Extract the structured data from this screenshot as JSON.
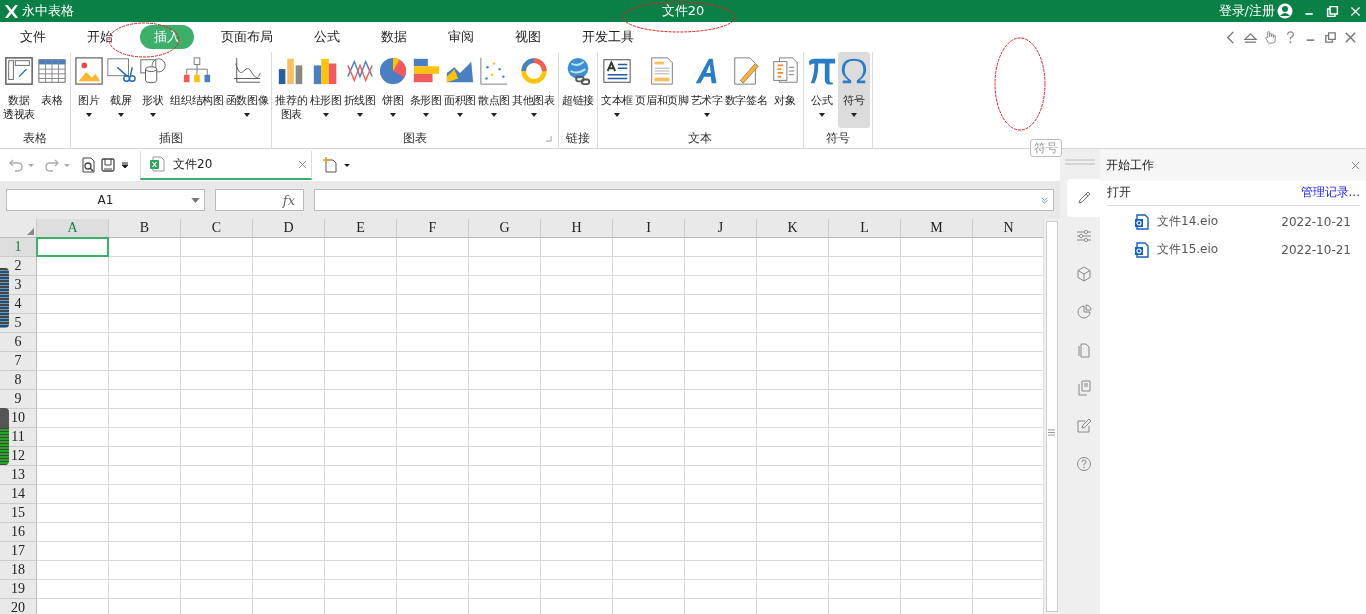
{
  "app": {
    "name": "永中表格"
  },
  "window": {
    "title": "文件20",
    "account_link": "登录/注册"
  },
  "menu_tabs": [
    {
      "label": "文件",
      "selected": false
    },
    {
      "label": "开始",
      "selected": false
    },
    {
      "label": "插入",
      "selected": true
    },
    {
      "label": "页面布局",
      "selected": false
    },
    {
      "label": "公式",
      "selected": false
    },
    {
      "label": "数据",
      "selected": false
    },
    {
      "label": "审阅",
      "selected": false
    },
    {
      "label": "视图",
      "selected": false
    },
    {
      "label": "开发工具",
      "selected": false
    }
  ],
  "ribbon_groups": [
    {
      "label": "表格",
      "launcher": false,
      "buttons": [
        {
          "label": "数据",
          "label_2": "透视表",
          "dropdown": false,
          "selected": false
        },
        {
          "label": "表格",
          "dropdown": false,
          "selected": false
        }
      ]
    },
    {
      "label": "插图",
      "launcher": false,
      "buttons": [
        {
          "label": "图片",
          "dropdown": true,
          "selected": false
        },
        {
          "label": "截屏",
          "dropdown": true,
          "selected": false
        },
        {
          "label": "形状",
          "dropdown": true,
          "selected": false
        },
        {
          "label": "组织结构图",
          "dropdown": false,
          "selected": false
        },
        {
          "label": "函数图像",
          "dropdown": true,
          "selected": false
        }
      ]
    },
    {
      "label": "图表",
      "launcher": true,
      "buttons": [
        {
          "label": "推荐的",
          "label_2": "图表",
          "dropdown": false,
          "selected": false
        },
        {
          "label": "柱形图",
          "dropdown": true,
          "selected": false
        },
        {
          "label": "折线图",
          "dropdown": true,
          "selected": false
        },
        {
          "label": "饼图",
          "dropdown": true,
          "selected": false
        },
        {
          "label": "条形图",
          "dropdown": true,
          "selected": false
        },
        {
          "label": "面积图",
          "dropdown": true,
          "selected": false
        },
        {
          "label": "散点图",
          "dropdown": true,
          "selected": false
        },
        {
          "label": "其他图表",
          "dropdown": true,
          "selected": false
        }
      ]
    },
    {
      "label": "链接",
      "launcher": false,
      "buttons": [
        {
          "label": "超链接",
          "dropdown": false,
          "selected": false
        }
      ]
    },
    {
      "label": "文本",
      "launcher": false,
      "buttons": [
        {
          "label": "文本框",
          "dropdown": true,
          "selected": false
        },
        {
          "label": "页眉和页脚",
          "dropdown": false,
          "selected": false
        },
        {
          "label": "艺术字",
          "dropdown": true,
          "selected": false
        },
        {
          "label": "数字签名",
          "dropdown": false,
          "selected": false
        },
        {
          "label": "对象",
          "dropdown": false,
          "selected": false
        }
      ]
    },
    {
      "label": "符号",
      "launcher": false,
      "buttons": [
        {
          "label": "公式",
          "dropdown": true,
          "selected": false
        },
        {
          "label": "符号",
          "dropdown": true,
          "selected": true
        }
      ]
    }
  ],
  "tooltip": "符号",
  "doc_tabs": [
    {
      "label": "文件20",
      "selected": true
    }
  ],
  "name_box": {
    "value": "A1"
  },
  "function_label": "fx",
  "columns": [
    {
      "label": "A",
      "selected": true
    },
    {
      "label": "B",
      "selected": false
    },
    {
      "label": "C",
      "selected": false
    },
    {
      "label": "D",
      "selected": false
    },
    {
      "label": "E",
      "selected": false
    },
    {
      "label": "F",
      "selected": false
    },
    {
      "label": "G",
      "selected": false
    },
    {
      "label": "H",
      "selected": false
    },
    {
      "label": "I",
      "selected": false
    },
    {
      "label": "J",
      "selected": false
    },
    {
      "label": "K",
      "selected": false
    },
    {
      "label": "L",
      "selected": false
    },
    {
      "label": "M",
      "selected": false
    },
    {
      "label": "N",
      "selected": false
    }
  ],
  "rows": [
    {
      "label": "1",
      "selected": true
    },
    {
      "label": "2",
      "selected": false
    },
    {
      "label": "3",
      "selected": false
    },
    {
      "label": "4",
      "selected": false
    },
    {
      "label": "5",
      "selected": false
    },
    {
      "label": "6",
      "selected": false
    },
    {
      "label": "7",
      "selected": false
    },
    {
      "label": "8",
      "selected": false
    },
    {
      "label": "9",
      "selected": false
    },
    {
      "label": "10",
      "selected": false
    },
    {
      "label": "11",
      "selected": false
    },
    {
      "label": "12",
      "selected": false
    },
    {
      "label": "13",
      "selected": false
    },
    {
      "label": "14",
      "selected": false
    },
    {
      "label": "15",
      "selected": false
    },
    {
      "label": "16",
      "selected": false
    },
    {
      "label": "17",
      "selected": false
    },
    {
      "label": "18",
      "selected": false
    },
    {
      "label": "19",
      "selected": false
    },
    {
      "label": "20",
      "selected": false
    }
  ],
  "side_tabs": [
    {
      "selected": true
    },
    {
      "selected": false
    },
    {
      "selected": false
    },
    {
      "selected": false
    },
    {
      "selected": false
    },
    {
      "selected": false
    },
    {
      "selected": false
    },
    {
      "selected": false
    }
  ],
  "side_panel": {
    "title": "开始工作",
    "section": "打开",
    "manage_link": "管理记录...",
    "files": [
      {
        "name": "文件14.eio",
        "date": "2022-10-21"
      },
      {
        "name": "文件15.eio",
        "date": "2022-10-21"
      }
    ]
  }
}
